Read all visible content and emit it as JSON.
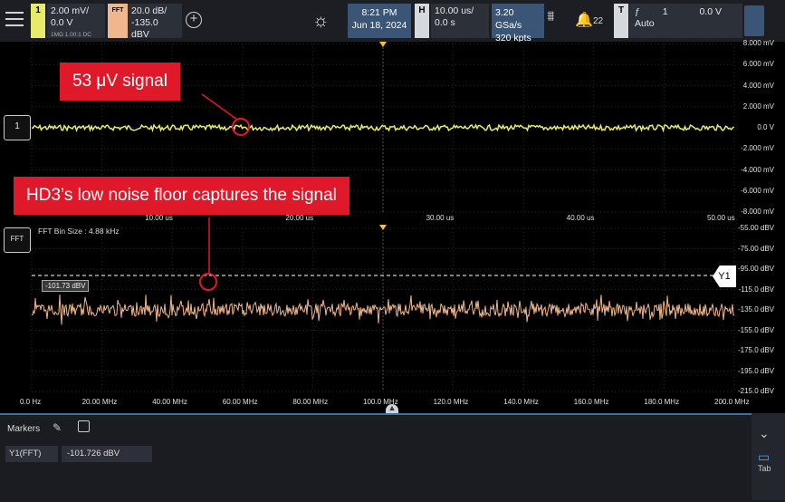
{
  "topbar": {
    "ch1": {
      "label": "1",
      "scale": "2.00 mV/",
      "offset": "0.0 V",
      "sub": "1MΩ  1.00:1  DC"
    },
    "fft": {
      "label": "FFT",
      "scale": "20.0 dB/",
      "offset": "-135.0 dBV"
    },
    "datetime": {
      "time": "8:21 PM",
      "date": "Jun 18, 2024"
    },
    "horizontal": {
      "label": "H",
      "scale": "10.00 us/",
      "delay": "0.0 s"
    },
    "acquisition": {
      "rate": "3.20 GSa/s",
      "points": "320 kpts"
    },
    "alerts": {
      "count": "22"
    },
    "trigger": {
      "label": "T",
      "source": "1",
      "level": "0.0 V",
      "mode": "Auto"
    }
  },
  "callouts": {
    "signal": "53 μV signal",
    "noise": "HD3’s low noise floor captures the signal"
  },
  "waveform": {
    "y_labels": [
      "8.000 mV",
      "6.000 mV",
      "4.000 mV",
      "2.000 mV",
      "0.0 V",
      "-2.000 mV",
      "-4.000 mV",
      "-6.000 mV",
      "-8.000 mV"
    ],
    "x_labels": [
      "10.00 us",
      "20.00 us",
      "30.00 us",
      "40.00 us",
      "50.00 us"
    ],
    "handle": "1"
  },
  "fft": {
    "bin_size": "FFT Bin Size : 4.88 kHz",
    "handle": "FFT",
    "cursor_readout": "-101.73 dBV",
    "y1_tag": "Y1",
    "y_labels": [
      "-55.00 dBV",
      "-75.00 dBV",
      "-95.00 dBV",
      "-115.0 dBV",
      "-135.0 dBV",
      "-155.0 dBV",
      "-175.0 dBV",
      "-195.0 dBV",
      "-215.0 dBV"
    ],
    "x_labels": [
      "0.0 Hz",
      "20.00 MHz",
      "40.00 MHz",
      "60.00 MHz",
      "80.00 MHz",
      "100.0 MHz",
      "120.0 MHz",
      "140.0 MHz",
      "160.0 MHz",
      "180.0 MHz",
      "200.0 MHz"
    ]
  },
  "markers": {
    "title": "Markers",
    "rows": [
      {
        "name": "Y1(FFT)",
        "value": "-101.726 dBV"
      }
    ]
  },
  "side": {
    "tab_label": "Tab"
  },
  "colors": {
    "ch1": "#e8ea6a",
    "fft": "#f0b78c",
    "callout": "#e0192a",
    "accent": "#3a5576"
  }
}
